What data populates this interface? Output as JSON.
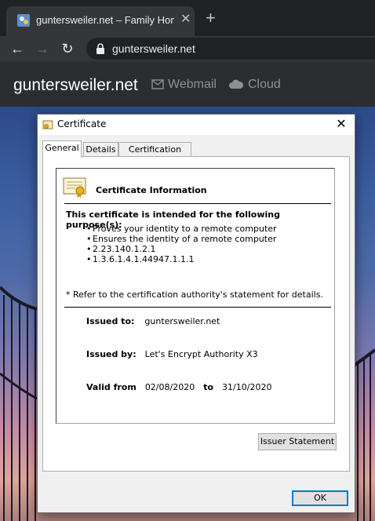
{
  "browser": {
    "tab_title": "guntersweiler.net – Family Home",
    "tab_close_icon": "close-icon",
    "new_tab_icon": "plus-icon",
    "url": "guntersweiler.net",
    "back_icon": "arrow-left-icon",
    "forward_icon": "arrow-right-icon",
    "reload_icon": "reload-icon",
    "lock_icon": "lock-icon"
  },
  "site": {
    "brand": "guntersweiler.net",
    "nav": [
      {
        "label": "Webmail",
        "icon": "envelope-icon"
      },
      {
        "label": "Cloud",
        "icon": "cloud-icon"
      }
    ]
  },
  "dialog": {
    "title": "Certificate",
    "tabs": [
      "General",
      "Details",
      "Certification Path"
    ],
    "active_tab": "General",
    "heading": "Certificate Information",
    "purpose_title": "This certificate is intended for the following purpose(s):",
    "purposes": [
      "Proves your identity to a remote computer",
      "Ensures the identity of a remote computer",
      "2.23.140.1.2.1",
      "1.3.6.1.4.1.44947.1.1.1"
    ],
    "refer_note": "* Refer to the certification authority's statement for details.",
    "issued_to_label": "Issued to:",
    "issued_to": "guntersweiler.net",
    "issued_by_label": "Issued by:",
    "issued_by": "Let's Encrypt Authority X3",
    "valid_from_label": "Valid from",
    "valid_from": "02/08/2020",
    "valid_to_label": "to",
    "valid_to": "31/10/2020",
    "issuer_statement_button": "Issuer Statement",
    "ok_button": "OK"
  },
  "colors": {
    "browser_bg": "#202124",
    "toolbar_bg": "#35363a",
    "site_header_bg": "#2b2d30",
    "dialog_bg": "#f0f0f0",
    "accent": "#0078d7"
  }
}
